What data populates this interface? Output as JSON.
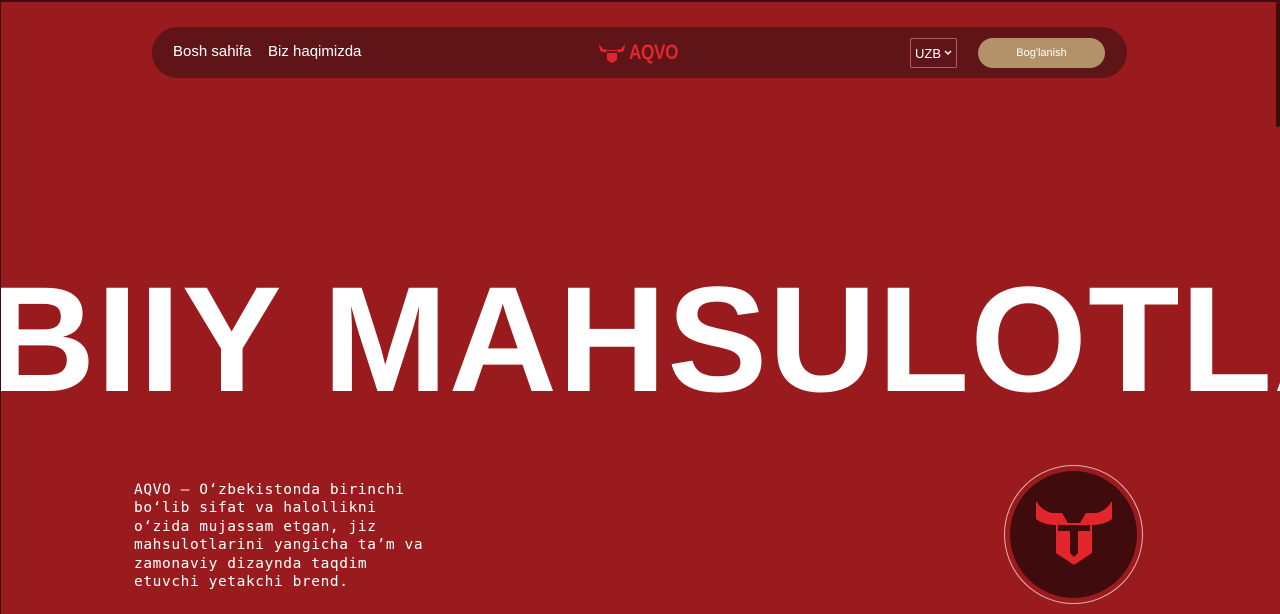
{
  "nav": {
    "home": "Bosh sahifa",
    "about": "Biz haqimizda",
    "logo_text": "AQVO",
    "language": "UZB",
    "contact_button": "Bog'lanish"
  },
  "hero": {
    "marquee_text": "BIIY MAHSULOTLA",
    "description": "AQVO – O‘zbekistonda birinchi bo‘lib sifat va halollikni o‘zida mujassam etgan, jiz mahsulotlarini yangicha ta’m va zamonaviy dizaynda taqdim etuvchi yetakchi brend."
  },
  "colors": {
    "background": "#9a1b1d",
    "navbar": "#5f1417",
    "accent_red": "#e3262b",
    "button": "#b39169",
    "badge_bg": "#3f0b0c"
  },
  "icons": {
    "logo": "bull-head-icon",
    "language_dropdown": "chevron-down-icon",
    "badge": "bull-head-icon"
  }
}
